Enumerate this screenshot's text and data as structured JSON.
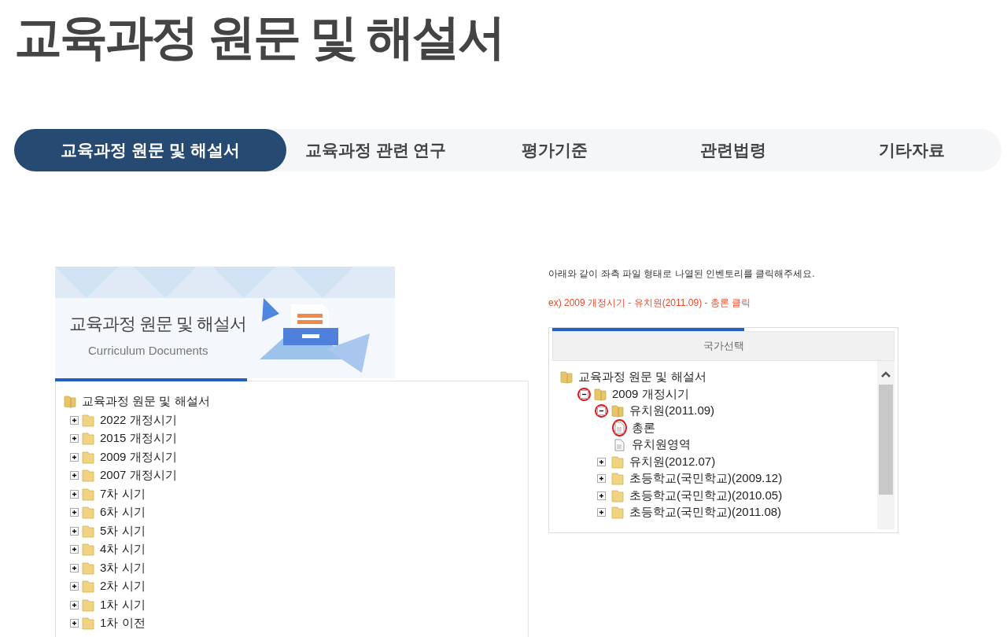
{
  "page_title": "교육과정 원문 및 해설서",
  "tabs": [
    {
      "label": "교육과정 원문 및 해설서",
      "selected": true
    },
    {
      "label": "교육과정 관련 연구",
      "selected": false
    },
    {
      "label": "평가기준",
      "selected": false
    },
    {
      "label": "관련법령",
      "selected": false
    },
    {
      "label": "기타자료",
      "selected": false
    }
  ],
  "banner": {
    "title": "교육과정 원문 및 해설서",
    "subtitle": "Curriculum Documents"
  },
  "left_tree": {
    "label": "교육과정 원문 및 해설서",
    "kind": "folder",
    "expanded": true,
    "children": [
      {
        "label": "2022 개정시기",
        "kind": "folder",
        "expanded": false
      },
      {
        "label": "2015 개정시기",
        "kind": "folder",
        "expanded": false
      },
      {
        "label": "2009 개정시기",
        "kind": "folder",
        "expanded": false
      },
      {
        "label": "2007 개정시기",
        "kind": "folder",
        "expanded": false
      },
      {
        "label": "7차 시기",
        "kind": "folder",
        "expanded": false
      },
      {
        "label": "6차 시기",
        "kind": "folder",
        "expanded": false
      },
      {
        "label": "5차 시기",
        "kind": "folder",
        "expanded": false
      },
      {
        "label": "4차 시기",
        "kind": "folder",
        "expanded": false
      },
      {
        "label": "3차 시기",
        "kind": "folder",
        "expanded": false
      },
      {
        "label": "2차 시기",
        "kind": "folder",
        "expanded": false
      },
      {
        "label": "1차 시기",
        "kind": "folder",
        "expanded": false
      },
      {
        "label": "1차 이전",
        "kind": "folder",
        "expanded": false
      }
    ]
  },
  "guide": {
    "instruction": "아래와 같이 좌측 파일 형태로 나열된 인벤토리를 클릭해주세요.",
    "example": "ex) 2009 개정시기 - 유치원(2011.09) - 총론 클릭"
  },
  "example_panel": {
    "header": "국가선택",
    "tree": {
      "label": "교육과정 원문 및 해설서",
      "kind": "folder",
      "expanded": true,
      "children": [
        {
          "label": "2009 개정시기",
          "kind": "folder",
          "expanded": true,
          "highlighted": true,
          "children": [
            {
              "label": "유치원(2011.09)",
              "kind": "folder",
              "expanded": true,
              "highlighted": true,
              "children": [
                {
                  "label": "총론",
                  "kind": "doc",
                  "highlighted": true
                },
                {
                  "label": "유치원영역",
                  "kind": "doc",
                  "highlighted": false
                }
              ]
            },
            {
              "label": "유치원(2012.07)",
              "kind": "folder",
              "expanded": false,
              "highlighted": false
            },
            {
              "label": "초등학교(국민학교)(2009.12)",
              "kind": "folder",
              "expanded": false,
              "highlighted": false
            },
            {
              "label": "초등학교(국민학교)(2010.05)",
              "kind": "folder",
              "expanded": false,
              "highlighted": false
            },
            {
              "label": "초등학교(국민학교)(2011.08)",
              "kind": "folder",
              "expanded": false,
              "highlighted": false
            }
          ]
        }
      ]
    }
  }
}
